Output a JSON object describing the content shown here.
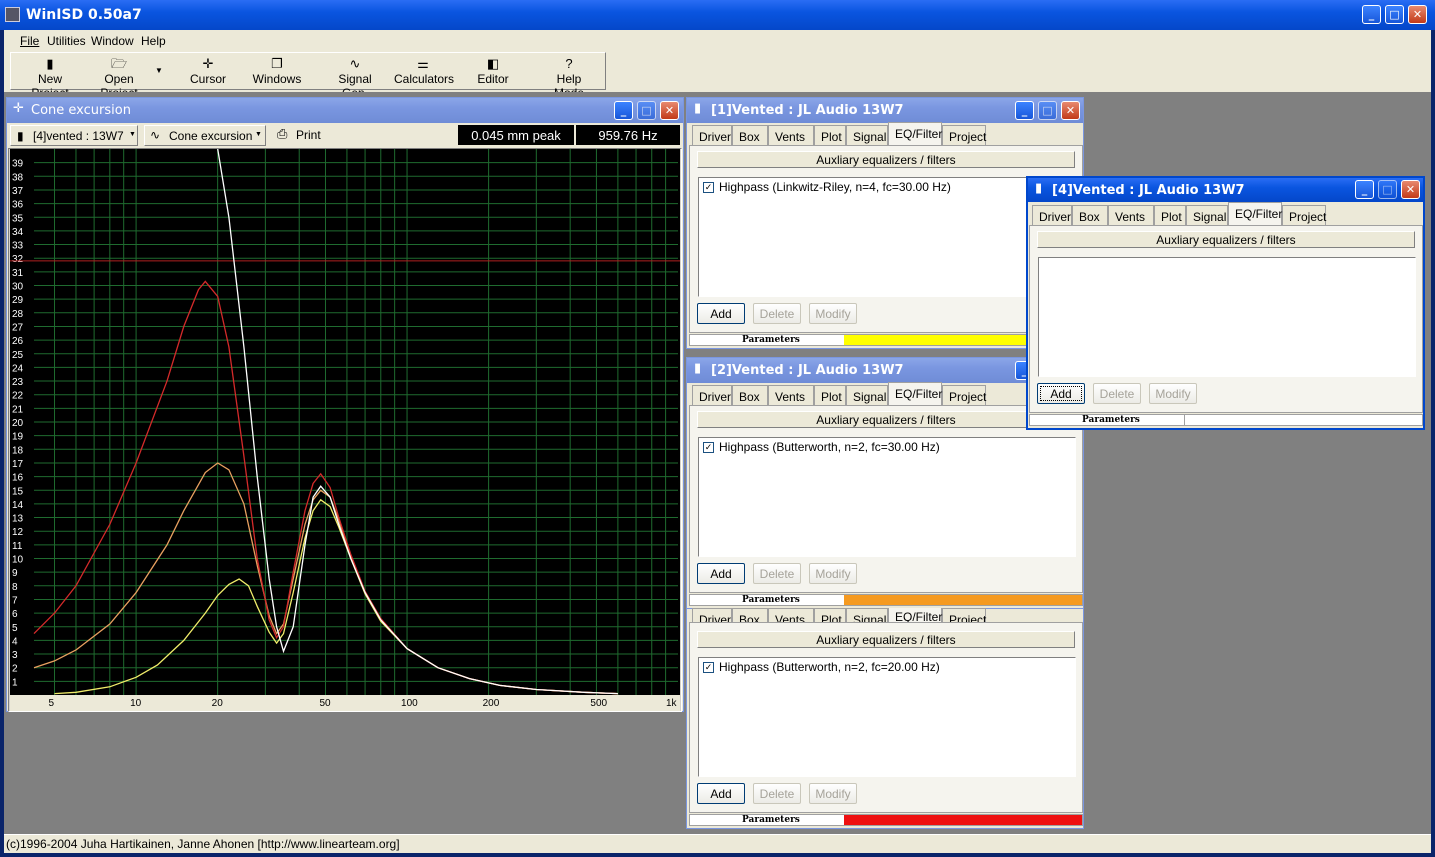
{
  "app": {
    "title": "WinISD 0.50a7",
    "menu": [
      "File",
      "Utilities",
      "Window",
      "Help"
    ],
    "toolbar": [
      {
        "label": "New Project",
        "icon": "new-project-icon"
      },
      {
        "label": "Open Project",
        "icon": "open-folder-icon"
      },
      {
        "label": "Cursor",
        "icon": "cursor-icon"
      },
      {
        "label": "Windows",
        "icon": "windows-icon"
      },
      {
        "label": "Signal Gen.",
        "icon": "sine-wave-icon"
      },
      {
        "label": "Calculators",
        "icon": "calculator-icon"
      },
      {
        "label": "Editor",
        "icon": "editor-icon"
      },
      {
        "label": "Help Mode",
        "icon": "question-icon"
      }
    ],
    "status": "(c)1996-2004 Juha Hartikainen, Janne Ahonen [http://www.linearteam.org]"
  },
  "graph_window": {
    "title": "Cone excursion",
    "project_select": "[4]vented : 13W7",
    "plot_select": "Cone excursion",
    "print_label": "Print",
    "readout_value": "0.045 mm peak",
    "readout_freq": "959.76 Hz"
  },
  "chart_data": {
    "type": "line",
    "title": "",
    "xlabel": "",
    "ylabel": "",
    "xscale": "log",
    "xlim": [
      4.2,
      1000
    ],
    "ylim": [
      0,
      40
    ],
    "x_ticks": [
      "5",
      "10",
      "20",
      "50",
      "100",
      "200",
      "500",
      "1k"
    ],
    "y_ticks": [
      1,
      2,
      3,
      4,
      5,
      6,
      7,
      8,
      9,
      10,
      11,
      12,
      13,
      14,
      15,
      16,
      17,
      18,
      19,
      20,
      21,
      22,
      23,
      24,
      25,
      26,
      27,
      28,
      29,
      30,
      31,
      32,
      33,
      34,
      35,
      36,
      37,
      38,
      39
    ],
    "limit_line": 31.8,
    "grid": true,
    "colors": {
      "background": "#000000",
      "grid": "#1f6b2f",
      "red": "#d42a2a",
      "orange": "#e8a060",
      "yellow": "#f0ec6a",
      "white": "#ffffff"
    },
    "series": [
      {
        "color": "#ffffff",
        "x": [
          20,
          22,
          25,
          28,
          31,
          33,
          35,
          38,
          42,
          45,
          48,
          52,
          56,
          62,
          70,
          80,
          100,
          130,
          170,
          220,
          300,
          450,
          600
        ],
        "y": [
          40,
          35,
          25.5,
          16,
          8.5,
          5,
          3.2,
          5,
          11,
          14.5,
          15.3,
          14.5,
          12.5,
          10,
          7.5,
          5.5,
          3.4,
          2,
          1.2,
          0.7,
          0.4,
          0.2,
          0.1
        ]
      },
      {
        "color": "#d42a2a",
        "x": [
          4.2,
          5,
          6,
          8,
          10,
          13,
          15,
          17,
          18,
          20,
          22,
          25,
          28,
          31,
          33,
          35,
          38,
          42,
          45,
          48,
          52,
          56,
          62,
          70,
          80,
          100,
          130,
          170,
          220,
          300,
          450,
          600
        ],
        "y": [
          4.5,
          6,
          8,
          12.5,
          17,
          23,
          27,
          29.7,
          30.3,
          29.2,
          25.5,
          17.5,
          10,
          5.5,
          4.2,
          5,
          9,
          13.5,
          15.5,
          16.2,
          15.2,
          13,
          10.3,
          7.6,
          5.6,
          3.4,
          2,
          1.2,
          0.7,
          0.4,
          0.2,
          0.1
        ]
      },
      {
        "color": "#e8a060",
        "x": [
          4.2,
          5,
          6,
          8,
          10,
          13,
          15,
          18,
          20,
          22,
          25,
          28,
          31,
          33,
          35,
          38,
          42,
          45,
          48,
          52,
          56,
          62,
          70,
          80,
          100,
          130,
          170,
          220,
          300,
          450,
          600
        ],
        "y": [
          2,
          2.5,
          3.3,
          5.2,
          7.5,
          11,
          13.5,
          16.3,
          17,
          16.5,
          14,
          9.5,
          5.8,
          4.5,
          5.2,
          8.5,
          12.5,
          14.3,
          15,
          14.5,
          12.8,
          10.2,
          7.5,
          5.5,
          3.4,
          2,
          1.2,
          0.7,
          0.4,
          0.2,
          0.1
        ]
      },
      {
        "color": "#f0ec6a",
        "x": [
          5,
          6,
          8,
          10,
          12,
          15,
          18,
          20,
          22,
          24,
          26,
          28,
          31,
          33,
          35,
          38,
          42,
          45,
          48,
          52,
          56,
          62,
          70,
          80,
          100,
          130,
          170,
          220,
          300,
          450,
          600
        ],
        "y": [
          0.1,
          0.2,
          0.6,
          1.3,
          2.2,
          4,
          6,
          7.3,
          8.1,
          8.5,
          8,
          6.5,
          4.6,
          3.8,
          4.5,
          7.5,
          11.5,
          13.5,
          14.3,
          13.8,
          12.3,
          10,
          7.4,
          5.4,
          3.4,
          2,
          1.2,
          0.7,
          0.4,
          0.2,
          0.1
        ]
      }
    ]
  },
  "tabs": [
    "Driver",
    "Box",
    "Vents",
    "Plot",
    "Signal",
    "EQ/Filter",
    "Project"
  ],
  "panel_common": {
    "group_title": "Auxliary equalizers / filters",
    "add": "Add",
    "delete": "Delete",
    "modify": "Modify",
    "parameters": "Parameters"
  },
  "windows": [
    {
      "title": "[1]Vented : JL Audio 13W7",
      "filter": "Highpass (Linkwitz-Riley, n=4, fc=30.00 Hz)",
      "color": "#ffff00"
    },
    {
      "title": "[2]Vented : JL Audio 13W7",
      "filter": "Highpass (Butterworth, n=2, fc=30.00 Hz)",
      "color": "#f59a20"
    },
    {
      "title": "",
      "filter": "Highpass (Butterworth, n=2, fc=20.00 Hz)",
      "color": "#ee1010"
    },
    {
      "title": "[4]Vented : JL Audio 13W7",
      "filter": "",
      "color": "#ffffff"
    }
  ]
}
